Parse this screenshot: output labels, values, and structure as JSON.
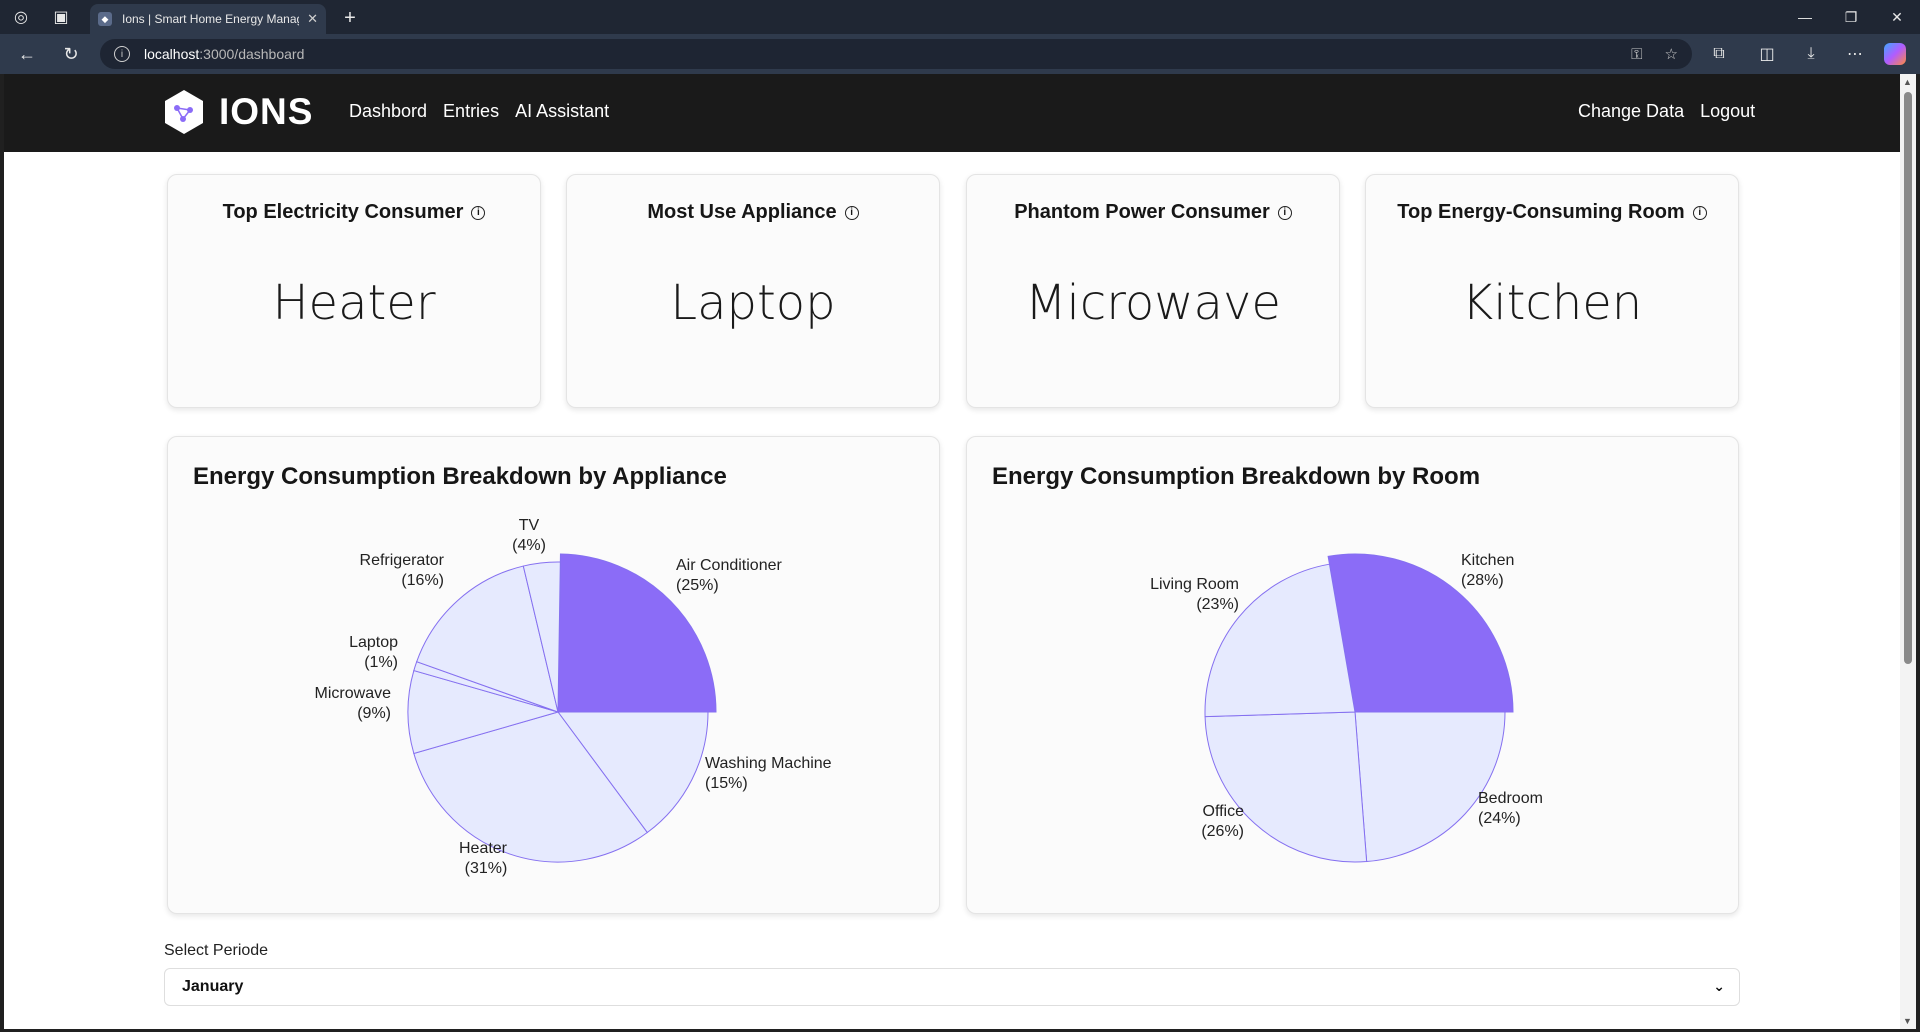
{
  "browser": {
    "tab_title": "Ions | Smart Home Energy Manag",
    "url_host": "localhost",
    "url_path": ":3000/dashboard"
  },
  "nav": {
    "brand": "IONS",
    "links": [
      "Dashbord",
      "Entries",
      "AI Assistant"
    ],
    "right_links": [
      "Change Data",
      "Logout"
    ]
  },
  "stats": [
    {
      "title": "Top Electricity Consumer",
      "value": "Heater"
    },
    {
      "title": "Most Use Appliance",
      "value": "Laptop"
    },
    {
      "title": "Phantom Power Consumer",
      "value": "Microwave"
    },
    {
      "title": "Top Energy-Consuming Room",
      "value": "Kitchen"
    }
  ],
  "chart_data": [
    {
      "type": "pie",
      "title": "Energy Consumption Breakdown by Appliance",
      "slices": [
        {
          "label": "Air Conditioner",
          "percent": "(25%)",
          "value": 25,
          "highlight": true
        },
        {
          "label": "Washing Machine",
          "percent": "(15%)",
          "value": 15
        },
        {
          "label": "Heater",
          "percent": "(31%)",
          "value": 31
        },
        {
          "label": "Microwave",
          "percent": "(9%)",
          "value": 9
        },
        {
          "label": "Laptop",
          "percent": "(1%)",
          "value": 1
        },
        {
          "label": "Refrigerator",
          "percent": "(16%)",
          "value": 16
        },
        {
          "label": "TV",
          "percent": "(4%)",
          "value": 4
        }
      ]
    },
    {
      "type": "pie",
      "title": "Energy Consumption Breakdown by Room",
      "slices": [
        {
          "label": "Kitchen",
          "percent": "(28%)",
          "value": 28,
          "highlight": true
        },
        {
          "label": "Bedroom",
          "percent": "(24%)",
          "value": 24
        },
        {
          "label": "Office",
          "percent": "(26%)",
          "value": 26
        },
        {
          "label": "Living Room",
          "percent": "(23%)",
          "value": 23
        }
      ]
    }
  ],
  "colors": {
    "highlight": "#8b6cf7",
    "slice_fill": "#e6eafe",
    "slice_stroke": "#8570f0"
  },
  "periode": {
    "label": "Select Periode",
    "selected": "January"
  }
}
